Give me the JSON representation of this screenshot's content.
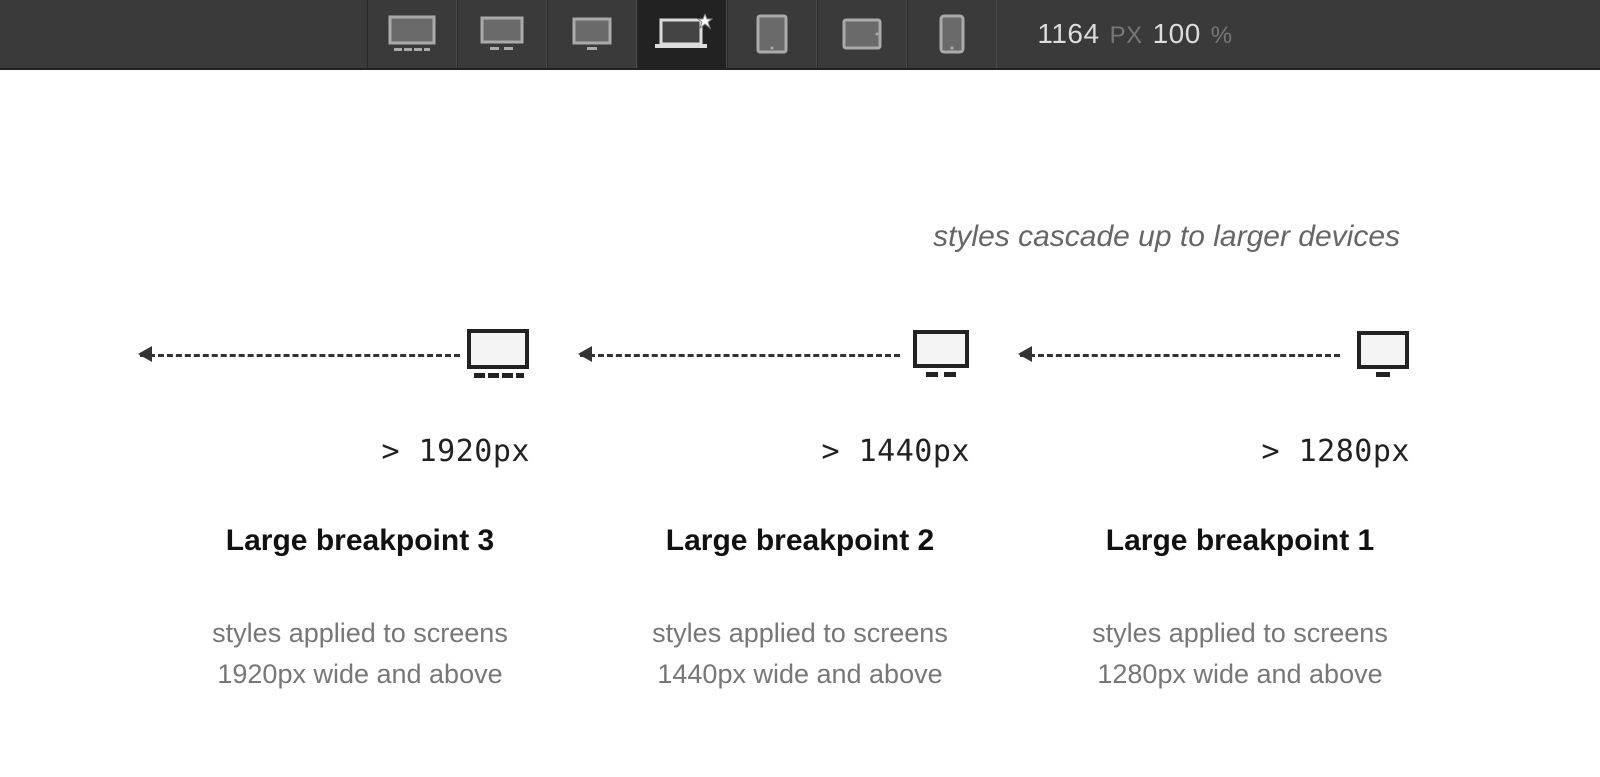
{
  "toolbar": {
    "devices": [
      {
        "name": "desktop-xl-icon",
        "active": false
      },
      {
        "name": "desktop-lg-icon",
        "active": false
      },
      {
        "name": "desktop-md-icon",
        "active": false
      },
      {
        "name": "laptop-base-icon",
        "active": true
      },
      {
        "name": "tablet-icon",
        "active": false
      },
      {
        "name": "tablet-landscape-icon",
        "active": false
      },
      {
        "name": "phone-icon",
        "active": false
      }
    ],
    "width_value": "1164",
    "width_unit": "PX",
    "zoom_value": "100",
    "zoom_unit": "%"
  },
  "diagram": {
    "caption": "styles cascade up to larger devices",
    "breakpoints": [
      {
        "icon": "desktop-xl-icon",
        "range": ">  1920px",
        "title": "Large breakpoint 3",
        "desc_line1": "styles applied to screens",
        "desc_line2": "1920px wide and above"
      },
      {
        "icon": "desktop-lg-icon",
        "range": ">  1440px",
        "title": "Large breakpoint 2",
        "desc_line1": "styles applied to screens",
        "desc_line2": "1440px wide and above"
      },
      {
        "icon": "desktop-md-icon",
        "range": ">  1280px",
        "title": "Large breakpoint 1",
        "desc_line1": "styles applied to screens",
        "desc_line2": "1280px wide and above"
      }
    ]
  }
}
